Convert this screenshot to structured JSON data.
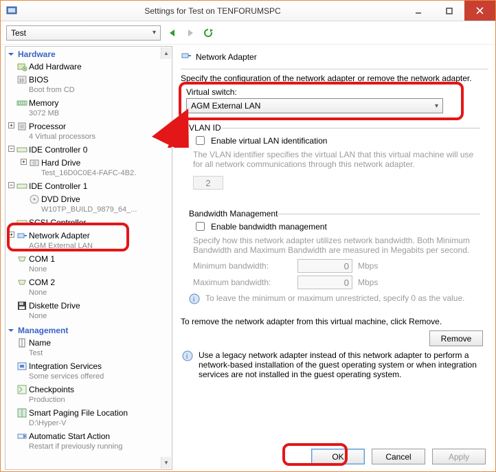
{
  "window": {
    "title": "Settings for Test on TENFORUMSPC"
  },
  "toolbar": {
    "vm_selector": "Test"
  },
  "sidebar": {
    "categories": [
      {
        "name": "Hardware",
        "items": [
          {
            "label": "Add Hardware",
            "sub": ""
          },
          {
            "label": "BIOS",
            "sub": "Boot from CD"
          },
          {
            "label": "Memory",
            "sub": "3072 MB"
          },
          {
            "label": "Processor",
            "sub": "4 Virtual processors",
            "expandable": true
          },
          {
            "label": "IDE Controller 0",
            "sub": "",
            "expandable": true
          },
          {
            "label": "Hard Drive",
            "sub": "Test_16D0C0E4-FAFC-4B2.",
            "level": 2,
            "expandable": true
          },
          {
            "label": "IDE Controller 1",
            "sub": "",
            "expandable": true
          },
          {
            "label": "DVD Drive",
            "sub": "W10TP_BUILD_9879_64_...",
            "level": 2
          },
          {
            "label": "SCSI Controller",
            "sub": ""
          },
          {
            "label": "Network Adapter",
            "sub": "AGM External LAN",
            "expandable": true,
            "highlighted": true
          },
          {
            "label": "COM 1",
            "sub": "None"
          },
          {
            "label": "COM 2",
            "sub": "None"
          },
          {
            "label": "Diskette Drive",
            "sub": "None"
          }
        ]
      },
      {
        "name": "Management",
        "items": [
          {
            "label": "Name",
            "sub": "Test"
          },
          {
            "label": "Integration Services",
            "sub": "Some services offered"
          },
          {
            "label": "Checkpoints",
            "sub": "Production"
          },
          {
            "label": "Smart Paging File Location",
            "sub": "D:\\Hyper-V"
          },
          {
            "label": "Automatic Start Action",
            "sub": "Restart if previously running"
          }
        ]
      }
    ]
  },
  "panel": {
    "title": "Network Adapter",
    "description": "Specify the configuration of the network adapter or remove the network adapter.",
    "virtual_switch_label": "Virtual switch:",
    "virtual_switch_value": "AGM External LAN",
    "vlan": {
      "group_title": "VLAN ID",
      "enable_label": "Enable virtual LAN identification",
      "hint": "The VLAN identifier specifies the virtual LAN that this virtual machine will use for all network communications through this network adapter.",
      "value": "2"
    },
    "bandwidth": {
      "group_title": "Bandwidth Management",
      "enable_label": "Enable bandwidth management",
      "hint": "Specify how this network adapter utilizes network bandwidth. Both Minimum Bandwidth and Maximum Bandwidth are measured in Megabits per second.",
      "min_label": "Minimum bandwidth:",
      "min_value": "0",
      "max_label": "Maximum bandwidth:",
      "max_value": "0",
      "unit": "Mbps",
      "note": "To leave the minimum or maximum unrestricted, specify 0 as the value."
    },
    "remove_text": "To remove the network adapter from this virtual machine, click Remove.",
    "remove_button": "Remove",
    "legacy_text": "Use a legacy network adapter instead of this network adapter to perform a network-based installation of the guest operating system or when integration services are not installed in the guest operating system."
  },
  "buttons": {
    "ok": "OK",
    "cancel": "Cancel",
    "apply": "Apply"
  }
}
